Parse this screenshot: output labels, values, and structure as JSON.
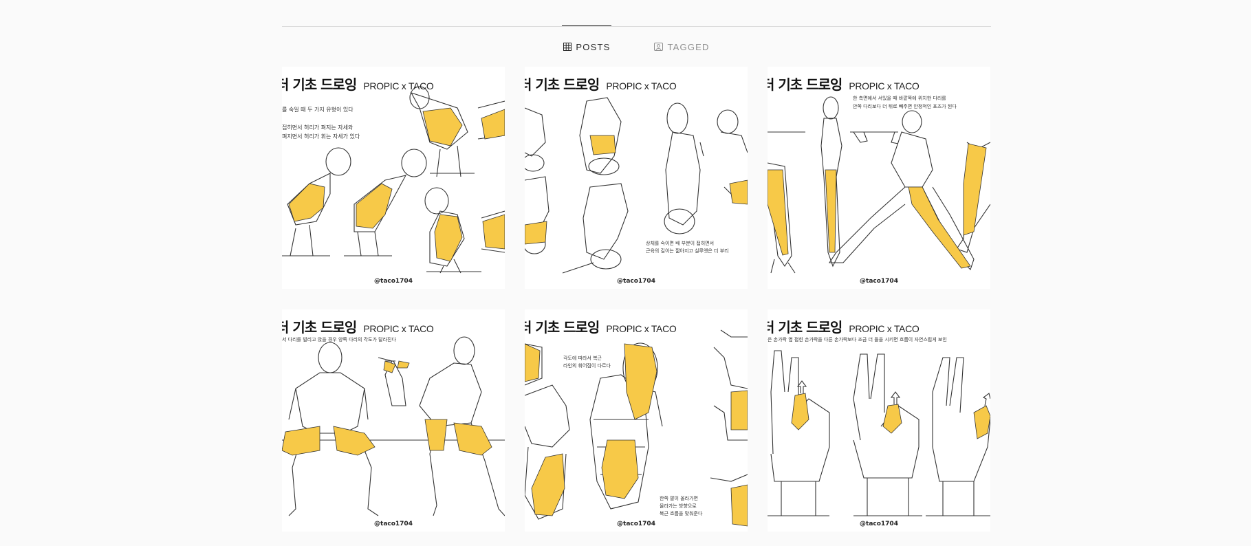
{
  "tabs": [
    {
      "label": "POSTS",
      "icon": "grid-icon",
      "active": true
    },
    {
      "label": "TAGGED",
      "icon": "tagged-person-icon",
      "active": false
    }
  ],
  "colors": {
    "accent": "#f7c948",
    "line": "#333333",
    "background": "#fafafa"
  },
  "posts": [
    {
      "title": "터 기초 드로잉",
      "brand": "PROPIC x TACO",
      "caption": "를 숙일 때 두 가지 유형이 있다\n\n접히면서 허리가 펴지는 자세와\n펴지면서 허리가 휘는 자세가 있다",
      "credit": "@taco1704"
    },
    {
      "title": "터 기초 드로잉",
      "brand": "PROPIC x TACO",
      "caption": "상체를 숙이면 배 부분이 접히면서\n근육의 길이는 짧아지고 실루엣은 더 부리",
      "credit": "@taco1704"
    },
    {
      "title": "터 기초 드로잉",
      "brand": "PROPIC x TACO",
      "caption": "한 측면에서 서있을 때 바깥쪽에 위치한 다리를\n안쪽 다리보다 더 뒤로 빼주면 안정적인 포즈가 된다",
      "credit": "@taco1704"
    },
    {
      "title": "터 기초 드로잉",
      "brand": "PROPIC x TACO",
      "caption": "서 다리를 벌리고 앉을 경우 양쪽 다리의 각도가 달라진다",
      "credit": "@taco1704"
    },
    {
      "title": "터 기초 드로잉",
      "brand": "PROPIC x TACO",
      "caption": "각도에 따라서 복근\n라인의 휘어짐이 다르다",
      "caption2": "한쪽 팔이 올라가면\n올라가는 방향으로\n복근 흐름을 맞춰준다",
      "credit": "@taco1704"
    },
    {
      "title": "터 기초 드로잉",
      "brand": "PROPIC x TACO",
      "caption": "은 손가락 옆 접힌 손가락을 다른 손가락보다 조금 더 들을 시키면 흐름이 자연스럽게 보인",
      "credit": "@taco1704"
    }
  ]
}
